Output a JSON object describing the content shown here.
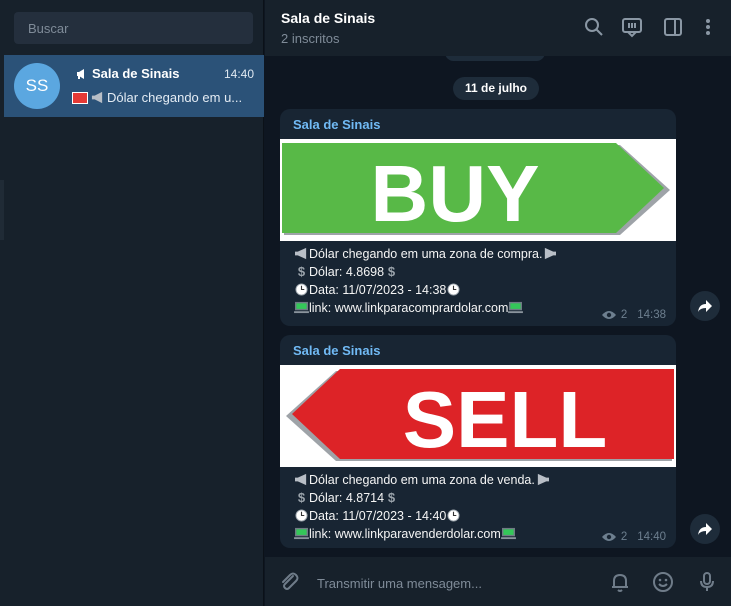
{
  "sidebar": {
    "search_placeholder": "Buscar",
    "chat": {
      "avatar_initials": "SS",
      "title": "Sala de Sinais",
      "time": "14:40",
      "preview": "Dólar chegando em u..."
    }
  },
  "header": {
    "title": "Sala de Sinais",
    "subtitle": "2 inscritos"
  },
  "messages": {
    "date_label": "11 de julho",
    "posts": [
      {
        "channel": "Sala de Sinais",
        "banner_text": "BUY",
        "banner_color": "#58b947",
        "line1": "Dólar chegando em uma zona de compra.",
        "line2": "Dólar: 4.8698",
        "line3": "Data: 11/07/2023 - 14:38",
        "line4": "link: www.linkparacomprardolar.com",
        "views": "2",
        "time": "14:38"
      },
      {
        "channel": "Sala de Sinais",
        "banner_text": "SELL",
        "banner_color": "#dd2327",
        "line1": "Dólar chegando em uma zona de venda.",
        "line2": "Dólar: 4.8714",
        "line3": "Data: 11/07/2023 - 14:40",
        "line4": "link: www.linkparavenderdolar.com",
        "views": "2",
        "time": "14:40"
      }
    ]
  },
  "composer": {
    "placeholder": "Transmitir uma mensagem..."
  }
}
